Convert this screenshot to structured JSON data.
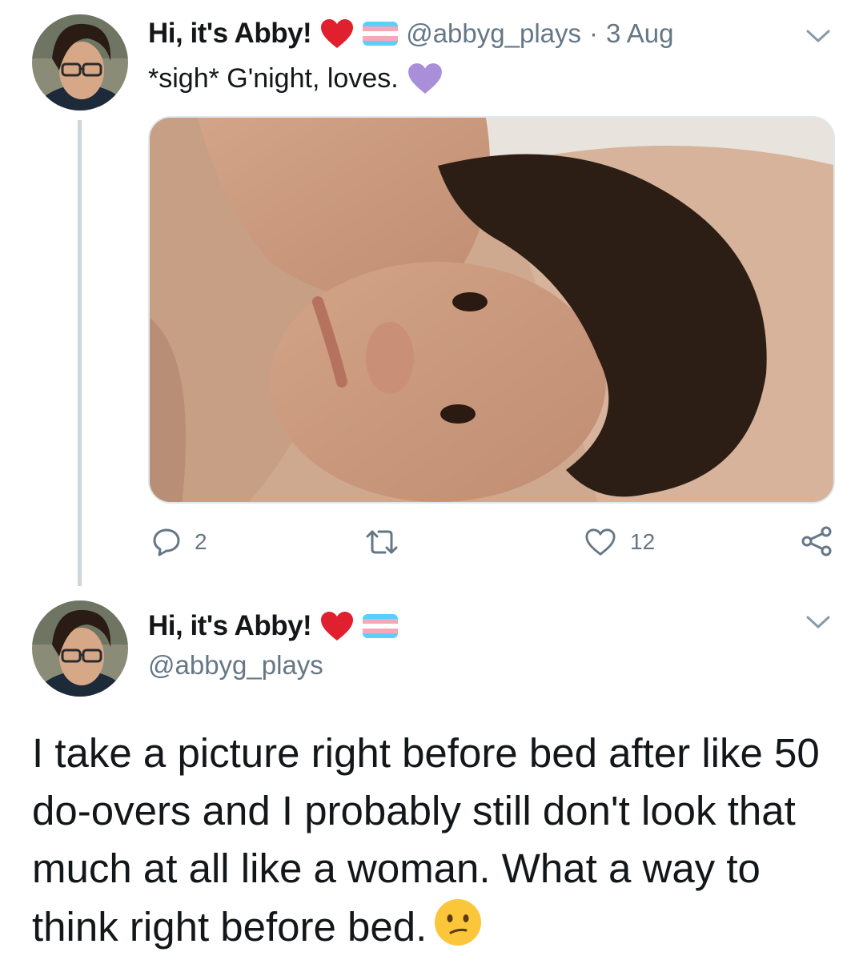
{
  "tweet1": {
    "display_name": "Hi, it's Abby!",
    "handle": "@abbyg_plays",
    "separator": "·",
    "date": "3 Aug",
    "text": "*sigh* G'night, loves.",
    "heart_color": "#e0202e",
    "purple_heart_color": "#a98ed9",
    "stats": {
      "replies": "2",
      "retweets": "",
      "likes": "12"
    }
  },
  "tweet2": {
    "display_name": "Hi, it's Abby!",
    "handle": "@abbyg_plays",
    "text": "I take a picture right before bed after like 50 do-overs and I probably still don't look that much at all like a woman.  What a way to think right before bed."
  },
  "flag_colors": [
    "#5bcefa",
    "#f5a9b8",
    "#ffffff",
    "#f5a9b8",
    "#5bcefa"
  ],
  "icons": {
    "reply": "speech-bubble-icon",
    "retweet": "retweet-arrows-icon",
    "like": "heart-outline-icon",
    "share": "share-nodes-icon",
    "menu": "chevron-down-icon",
    "emoji": "confused-face-emoji"
  }
}
